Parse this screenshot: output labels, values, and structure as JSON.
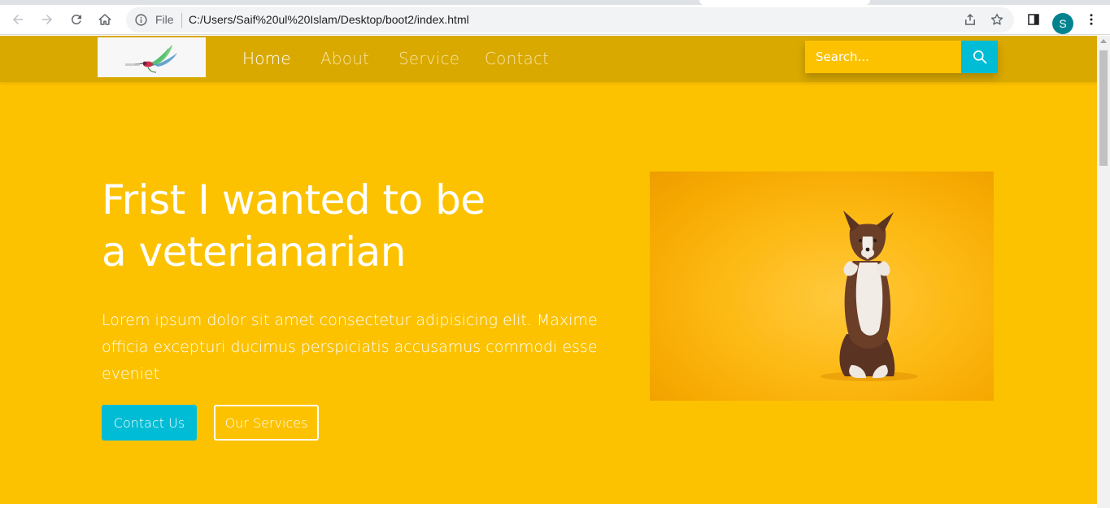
{
  "browser": {
    "address_prefix": "File",
    "url": "C:/Users/Saif%20ul%20Islam/Desktop/boot2/index.html",
    "profile_initial": "S"
  },
  "navbar": {
    "logo_alt": "logo",
    "links": [
      {
        "label": "Home",
        "active": true
      },
      {
        "label": "About",
        "active": false
      },
      {
        "label": "Service",
        "active": false
      },
      {
        "label": "Contact",
        "active": false
      }
    ],
    "search_placeholder": "Search..."
  },
  "hero": {
    "title_line1": "Frist I wanted to be",
    "title_line2": "a veterianarian",
    "text": "Lorem ipsum dolor sit amet consectetur adipisicing elit. Maxime officia excepturi ducimus perspiciatis accusamus commodi esse eveniet",
    "primary_button": "Contact Us",
    "secondary_button": "Our Services",
    "image_subject": "dog-standing-on-hind-legs"
  },
  "colors": {
    "page_bg": "#fcc200",
    "navbar_bg": "#d9a900",
    "accent": "#00bcd4",
    "text": "#ffffff"
  }
}
